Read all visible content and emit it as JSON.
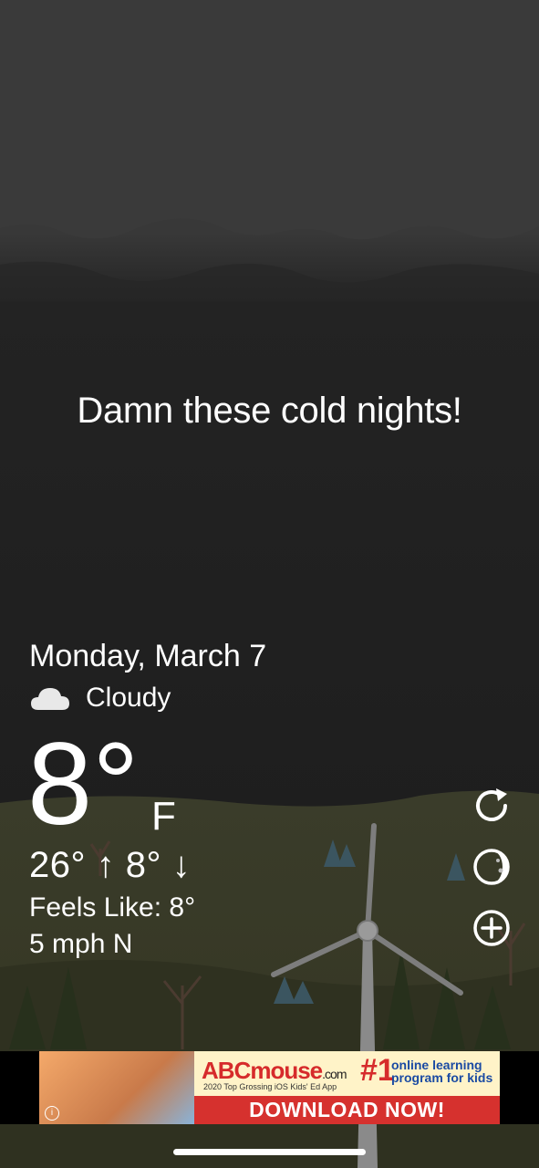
{
  "message": "Damn these cold nights!",
  "weather": {
    "date": "Monday, March 7",
    "condition": "Cloudy",
    "condition_icon": "cloud-icon",
    "temperature": "8°",
    "unit": "F",
    "high_low": "26° ↑ 8° ↓",
    "feels_like": "Feels Like: 8°",
    "wind": "5 mph N"
  },
  "side_buttons": [
    "refresh-icon",
    "moon-phase-icon",
    "add-location-icon"
  ],
  "ad": {
    "logo_text": "ABCmouse",
    "logo_suffix": ".com",
    "tagline": "2020 Top Grossing iOS Kids' Ed App",
    "rank": "#1",
    "subtitle": "online learning program for kids",
    "cta": "DOWNLOAD NOW!"
  },
  "colors": {
    "sky": "#1c1c1c",
    "hills": "#3c3f2c",
    "ad_red": "#d6312e"
  }
}
